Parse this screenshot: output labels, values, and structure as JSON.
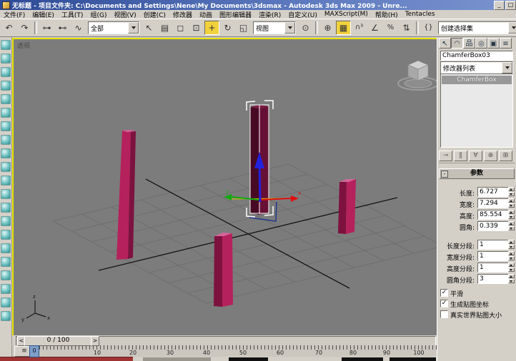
{
  "window": {
    "title": "无标题 - 项目文件夹: C:\\Documents and Settings\\Nene\\My Documents\\3dsmax  -  Autodesk 3ds Max 2009  -  Unre...",
    "minimize": "_",
    "maximize": "□"
  },
  "menu": {
    "items": [
      "文件(F)",
      "编辑(E)",
      "工具(T)",
      "组(G)",
      "视图(V)",
      "创建(C)",
      "修改器",
      "动画",
      "图形编辑器",
      "渲染(R)",
      "自定义(U)",
      "MAXScript(M)",
      "帮助(H)",
      "Tentacles"
    ]
  },
  "toolbar": {
    "selection_filter": "全部",
    "reference_coord": "视图",
    "selection_set": "创建选择集",
    "buttons": [
      {
        "name": "undo",
        "glyph": "↶"
      },
      {
        "name": "redo",
        "glyph": "↷"
      },
      {
        "name": "select-and-link",
        "glyph": "⊶"
      },
      {
        "name": "unlink-selection",
        "glyph": "⊷"
      },
      {
        "name": "bind-to-space-warp",
        "glyph": "∿"
      },
      {
        "name": "select-object",
        "glyph": "↖"
      },
      {
        "name": "select-by-name",
        "glyph": "▤"
      },
      {
        "name": "rectangular-selection-region",
        "glyph": "◻"
      },
      {
        "name": "window-crossing-toggle",
        "glyph": "⊡"
      },
      {
        "name": "select-and-move",
        "glyph": "+"
      },
      {
        "name": "select-and-rotate",
        "glyph": "↻"
      },
      {
        "name": "select-and-scale",
        "glyph": "◱"
      },
      {
        "name": "use-center",
        "glyph": "⊙"
      },
      {
        "name": "select-and-manipulate",
        "glyph": "⊕"
      },
      {
        "name": "keyboard-shortcut-override",
        "glyph": "▦"
      },
      {
        "name": "snaps-toggle-3d",
        "glyph": "∩³"
      },
      {
        "name": "angle-snap",
        "glyph": "∠"
      },
      {
        "name": "percent-snap",
        "glyph": "%"
      },
      {
        "name": "spinner-snap",
        "glyph": "⇅"
      },
      {
        "name": "edit-named-selection-sets",
        "glyph": "{}"
      },
      {
        "name": "mirror",
        "glyph": "◧"
      }
    ]
  },
  "viewport": {
    "label": "透视",
    "axis_x": "x",
    "axis_y": "y",
    "axis_z": "z"
  },
  "panel": {
    "tabs": [
      {
        "name": "create-tab",
        "glyph": "↖"
      },
      {
        "name": "modify-tab",
        "glyph": "◠"
      },
      {
        "name": "hierarchy-tab",
        "glyph": "品"
      },
      {
        "name": "motion-tab",
        "glyph": "◎"
      },
      {
        "name": "display-tab",
        "glyph": "▣"
      },
      {
        "name": "utilities-tab",
        "glyph": "≡"
      }
    ],
    "object_name": "ChamferBox03",
    "modifier_list": "修改器列表",
    "stack_items": [
      {
        "label": "ChamferBox"
      }
    ],
    "stack_tools": [
      {
        "name": "pin-stack",
        "glyph": "⊸"
      },
      {
        "name": "show-end-result",
        "glyph": "‖"
      },
      {
        "name": "make-unique",
        "glyph": "∀"
      },
      {
        "name": "remove-modifier",
        "glyph": "⊗"
      },
      {
        "name": "configure-modifier-sets",
        "glyph": "⊞"
      }
    ],
    "rollout": {
      "collapse": "-",
      "title": "参数"
    },
    "params": [
      {
        "label": "长度:",
        "value": "6.727"
      },
      {
        "label": "宽度:",
        "value": "7.294"
      },
      {
        "label": "高度:",
        "value": "85.554"
      },
      {
        "label": "圆角:",
        "value": "0.339"
      }
    ],
    "segments": [
      {
        "label": "长度分段:",
        "value": "1"
      },
      {
        "label": "宽度分段:",
        "value": "1"
      },
      {
        "label": "高度分段:",
        "value": "1"
      },
      {
        "label": "圆角分段:",
        "value": "3"
      }
    ],
    "checkboxes": [
      {
        "label": "平滑",
        "checked": true
      },
      {
        "label": "生成贴图坐标",
        "checked": true
      },
      {
        "label": "真实世界贴图大小",
        "checked": false
      }
    ]
  },
  "timeline": {
    "slider": "0 / 100",
    "prev": "<",
    "next": ">",
    "frame": "0",
    "curve_editor": "≡",
    "ticks": [
      "10",
      "20",
      "30",
      "40",
      "50",
      "60",
      "70",
      "80",
      "90",
      "100"
    ]
  },
  "icons": {
    "check": "✓"
  }
}
